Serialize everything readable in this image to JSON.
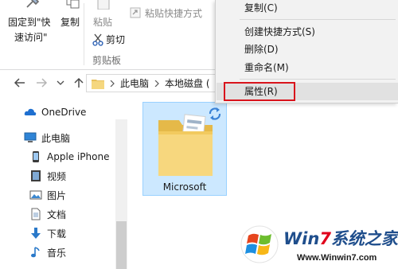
{
  "ribbon": {
    "pin_label_line1": "固定到\"快",
    "pin_label_line2": "速访问\"",
    "copy_label": "复制",
    "paste_label": "粘贴",
    "paste_shortcut_label": "粘贴快捷方式",
    "cut_label": "剪切",
    "clipboard_group_label": "剪贴板"
  },
  "address_bar": {
    "segments": [
      "此电脑",
      "本地磁盘 ("
    ]
  },
  "nav_pane": {
    "items": [
      {
        "label": "OneDrive",
        "icon": "cloud-icon"
      },
      {
        "label": "此电脑",
        "icon": "computer-icon"
      },
      {
        "label": "Apple iPhone",
        "icon": "phone-icon"
      },
      {
        "label": "视频",
        "icon": "video-icon"
      },
      {
        "label": "图片",
        "icon": "picture-icon"
      },
      {
        "label": "文档",
        "icon": "document-icon"
      },
      {
        "label": "下载",
        "icon": "download-icon"
      },
      {
        "label": "音乐",
        "icon": "music-icon"
      }
    ]
  },
  "content": {
    "selected_folder_name": "Microsoft"
  },
  "context_menu": {
    "items": [
      "复制(C)",
      "创建快捷方式(S)",
      "删除(D)",
      "重命名(M)",
      "属性(R)"
    ],
    "highlighted": "属性(R)"
  },
  "watermark": {
    "brand_prefix": "Win",
    "brand_seven": "7",
    "brand_suffix": "系统之家",
    "url": "Www.Winwin7.com"
  },
  "colors": {
    "selection_fill": "#cce8ff",
    "selection_border": "#99d1ff",
    "highlight_box": "#d9141c",
    "accent_blue": "#1f4e8c"
  }
}
